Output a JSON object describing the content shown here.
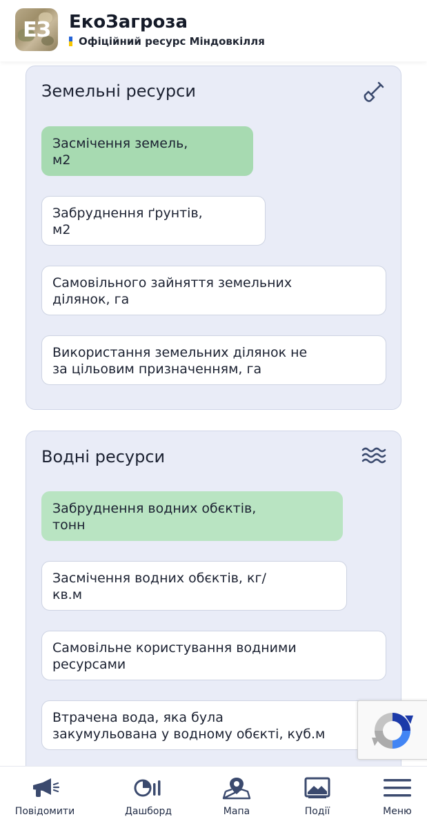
{
  "app": {
    "title": "ЕкоЗагроза",
    "subtitle": "Офіційний ресурс Міндовкілля",
    "logo_text": "ЕЗ"
  },
  "colors": {
    "accent_green": "#a7dab1",
    "card_bg": "#e9ecf7",
    "icon_color": "#3b4a6e"
  },
  "sections": {
    "land": {
      "title": "Земельні ресурси",
      "icon": "shovel-icon",
      "items": [
        {
          "line1": "Засмічення земель,",
          "line2": "м2",
          "selected": true
        },
        {
          "line1": "Забруднення ґрунтів,",
          "line2": "м2",
          "selected": false
        },
        {
          "line1": "Самовільного зайняття земельних",
          "line2": "ділянок, га",
          "selected": false
        },
        {
          "line1": "Використання земельних ділянок не",
          "line2": "за цільовим призначенням, га",
          "selected": false
        }
      ]
    },
    "water": {
      "title": "Водні ресурси",
      "icon": "waves-icon",
      "items": [
        {
          "line1": "Забруднення водних обєктів,",
          "line2": "тонн",
          "selected": true
        },
        {
          "line1": "Засмічення водних обєктів, кг/",
          "line2": "кв.м",
          "selected": false
        },
        {
          "line1": "Самовільне користування водними",
          "line2": "ресурсами",
          "selected": false
        },
        {
          "line1": "Втрачена вода, яка була",
          "line2": "закумульована у водному обєкті, куб.м",
          "selected": false
        }
      ]
    }
  },
  "bottom_nav": [
    {
      "label": "Повідомити",
      "icon": "megaphone-icon"
    },
    {
      "label": "Дашборд",
      "icon": "dashboard-icon"
    },
    {
      "label": "Мапа",
      "icon": "map-icon"
    },
    {
      "label": "Події",
      "icon": "events-icon"
    },
    {
      "label": "Меню",
      "icon": "menu-icon"
    }
  ]
}
